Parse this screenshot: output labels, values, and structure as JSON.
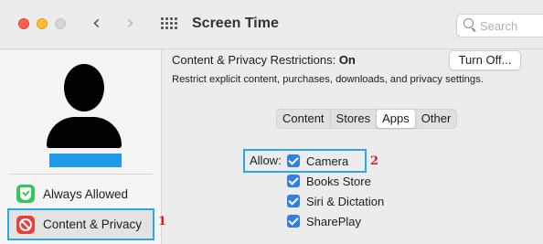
{
  "window": {
    "title": "Screen Time",
    "search_placeholder": "Search"
  },
  "sidebar": {
    "items": [
      {
        "label": "Always Allowed",
        "icon": "always-allowed-icon",
        "color": "#35c759"
      },
      {
        "label": "Content & Privacy",
        "icon": "content-privacy-icon",
        "color": "#e9403a",
        "selected": true
      }
    ]
  },
  "main": {
    "restrictions_label": "Content & Privacy Restrictions:",
    "restrictions_status": "On",
    "turn_off_label": "Turn Off...",
    "description": "Restrict explicit content, purchases, downloads, and privacy settings.",
    "tabs": [
      {
        "label": "Content"
      },
      {
        "label": "Stores"
      },
      {
        "label": "Apps",
        "active": true
      },
      {
        "label": "Other"
      }
    ],
    "allow_label": "Allow:",
    "apps": [
      {
        "label": "Camera",
        "checked": true
      },
      {
        "label": "Books Store",
        "checked": true
      },
      {
        "label": "Siri & Dictation",
        "checked": true
      },
      {
        "label": "SharePlay",
        "checked": true
      }
    ]
  },
  "callouts": {
    "one": "1",
    "two": "2"
  },
  "colors": {
    "highlight": "#2aa7e6",
    "callout": "#d42020",
    "checkbox": "#2f7fe6"
  }
}
